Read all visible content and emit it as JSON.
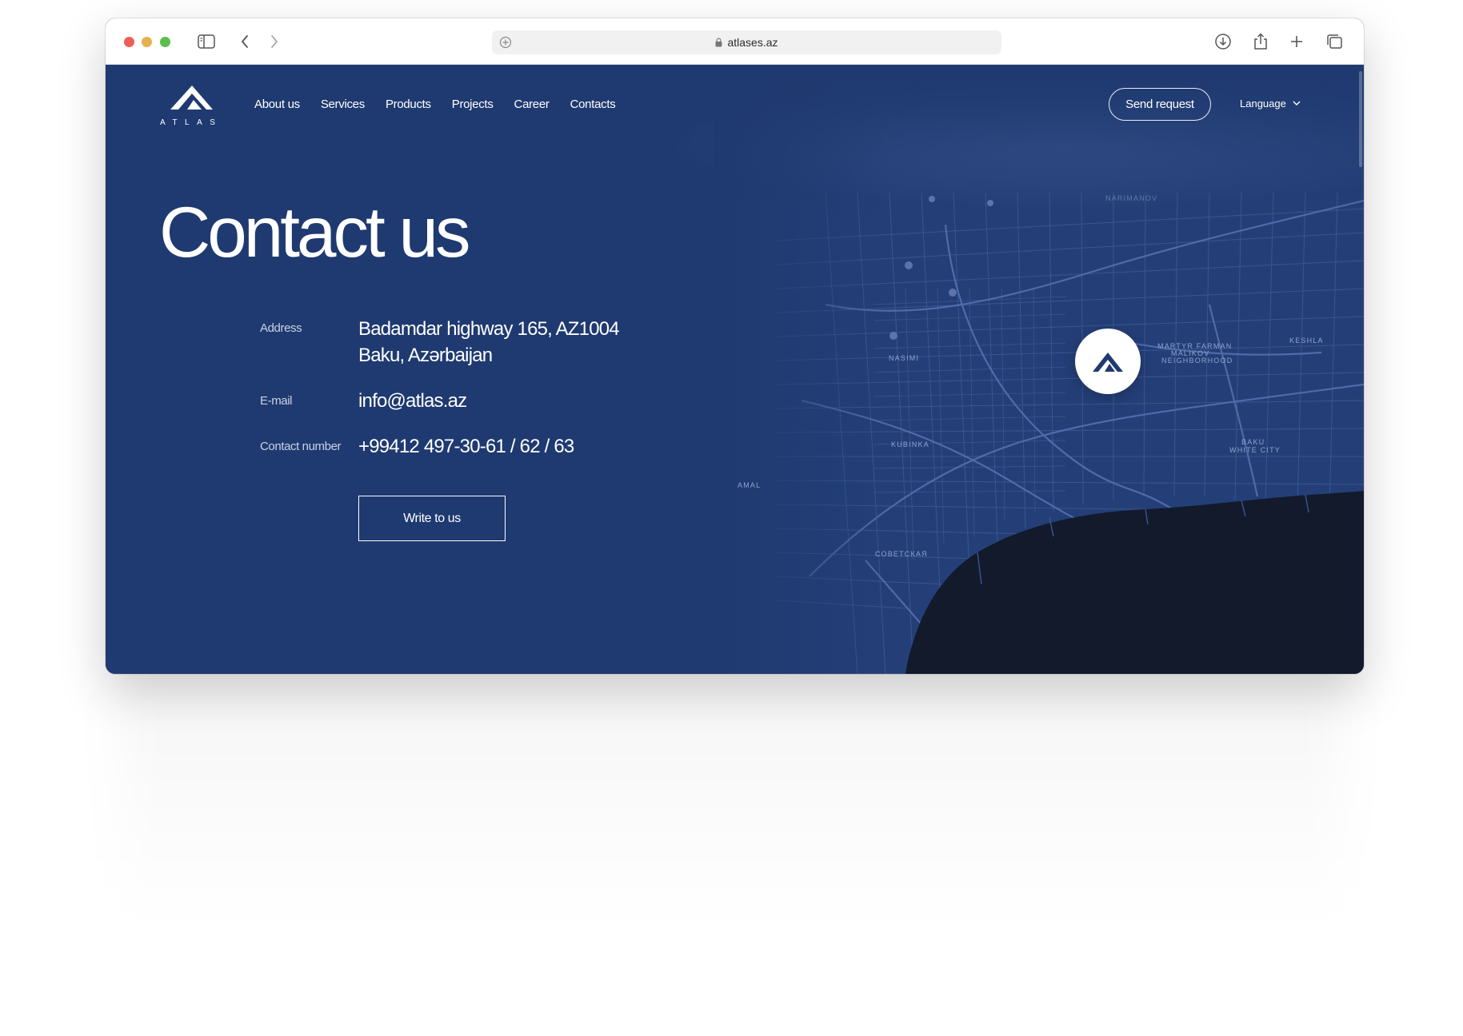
{
  "browser": {
    "url": "atlases.az"
  },
  "brand": {
    "logo_text": "ATLAS"
  },
  "nav": {
    "items": [
      "About us",
      "Services",
      "Products",
      "Projects",
      "Career",
      "Contacts"
    ]
  },
  "header": {
    "send_request": "Send request",
    "language": "Language"
  },
  "contact": {
    "title": "Contact us",
    "address_label": "Address",
    "address_line1": "Badamdar highway 165, AZ1004",
    "address_line2": "Baku, Azərbaijan",
    "email_label": "E-mail",
    "email": "info@atlas.az",
    "phone_label": "Contact number",
    "phone": "+99412 497-30-61 / 62 / 63",
    "write_button": "Write to us"
  },
  "map_labels": {
    "nasimi": "NASIMI",
    "kubinka": "KUBINKA",
    "sovetskaya": "СОВЕТСКАЯ",
    "martyr_farman_1": "MARTYR FARMAN",
    "martyr_farman_2": "MALIKOV",
    "martyr_farman_3": "NEIGHBORHOOD",
    "keshla": "KESHLA",
    "baku_white_1": "BAKU",
    "baku_white_2": "WHITE CITY",
    "amal": "AMAL",
    "nariman": "NARIMANOV"
  },
  "colors": {
    "page_bg": "#1f3a70",
    "sea": "#121a2b",
    "accent_white": "#ffffff"
  }
}
